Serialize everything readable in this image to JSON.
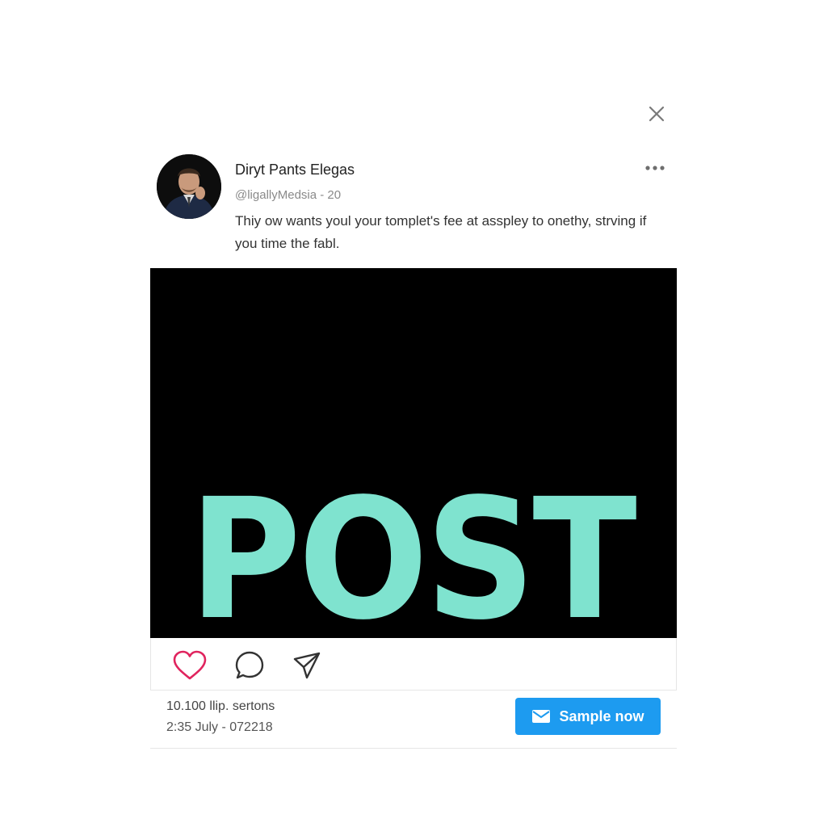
{
  "dialog": {
    "close_icon": "close-icon"
  },
  "post": {
    "author_name": "Diryt Pants Elegas",
    "author_handle": "@ligallyMedsia - 20",
    "text": "Thiy ow wants youl your tomplet's fee at asspley to onethy, strving if you time the fabl.",
    "more_icon": "more-icon",
    "image_text": "POST",
    "image_text_color": "#7fe3cf",
    "image_background": "#000000"
  },
  "actions": {
    "like_icon": "heart-icon",
    "comment_icon": "comment-icon",
    "share_icon": "send-icon",
    "like_color": "#e0245e"
  },
  "footer": {
    "stats": "10.100 llip. sertons",
    "timestamp": "2:35 July - 072218",
    "cta_label": "Sample now",
    "cta_icon": "envelope-icon",
    "cta_color": "#1d9bf0"
  }
}
